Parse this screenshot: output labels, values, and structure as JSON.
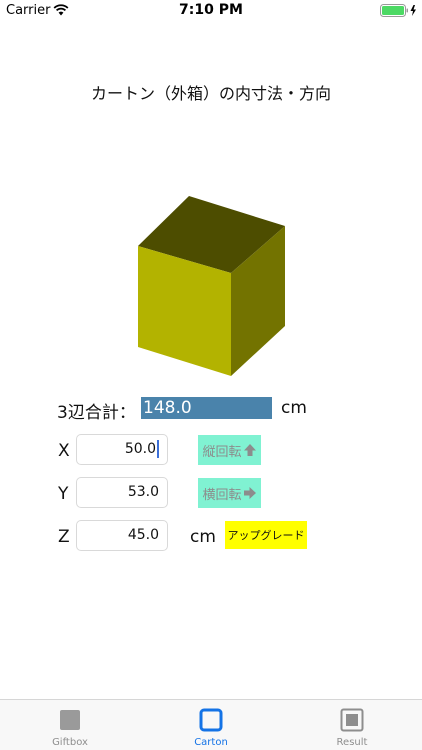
{
  "status_bar": {
    "carrier": "Carrier",
    "time": "7:10 PM"
  },
  "header": {
    "title": "カートン（外箱）の内寸法・方向"
  },
  "cube": {
    "colors": {
      "top": "#4d4d00",
      "front": "#b3b300",
      "side": "#737300"
    }
  },
  "summary": {
    "label": "3辺合計：",
    "value": "148.0",
    "unit": "cm"
  },
  "dimensions": [
    {
      "axis": "X",
      "value": "50.0"
    },
    {
      "axis": "Y",
      "value": "53.0"
    },
    {
      "axis": "Z",
      "value": "45.0",
      "unit": "cm"
    }
  ],
  "buttons": {
    "rotate_vertical": "縦回転",
    "rotate_horizontal": "横回転",
    "upgrade": "アップグレード"
  },
  "colors": {
    "accent_tab": "#1473e6",
    "rotate_button": "#80f2d2",
    "upgrade_button": "#ffff00",
    "sum_field": "#4a83ab"
  },
  "tab_bar": {
    "tabs": [
      {
        "label": "Giftbox",
        "active": false
      },
      {
        "label": "Carton",
        "active": true
      },
      {
        "label": "Result",
        "active": false
      }
    ]
  }
}
